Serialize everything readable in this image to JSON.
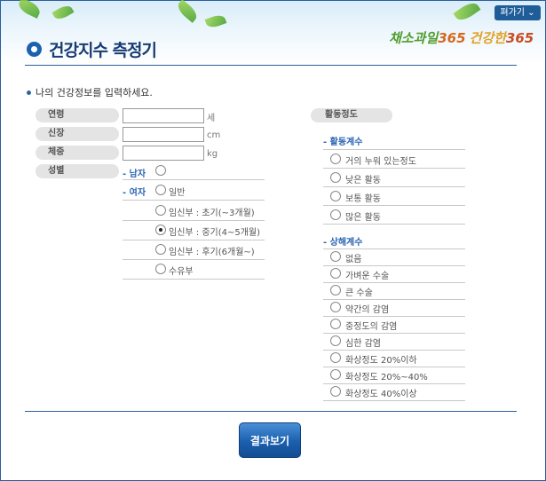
{
  "header": {
    "close_label": "펴가기 ⌄",
    "title": "건강지수 측정기",
    "brand_part1": "채소과일",
    "brand_part2": "365",
    "brand_part3": "건강한",
    "brand_part4": "365"
  },
  "intro": "나의 건강정보를 입력하세요.",
  "fields": {
    "age_label": "연령",
    "height_label": "신장",
    "height_unit": "cm",
    "weight_label": "체중",
    "weight_unit": "kg",
    "age_unit": "세",
    "gender_label": "성별",
    "age_value": "",
    "height_value": "",
    "weight_value": ""
  },
  "gender": {
    "male_label": "- 남자",
    "female_label": "- 여자",
    "female_options": [
      "일반",
      "임신부 : 초기(~3개월)",
      "임신부 : 중기(4~5개월)",
      "임신부 : 후기(6개월~)",
      "수유부"
    ],
    "selected": "임신부 : 중기(4~5개월)"
  },
  "activity": {
    "header_label": "활동정도",
    "activity_title": "- 활동계수",
    "activity_options": [
      "거의 누워 있는정도",
      "낮은 활동",
      "보통 활동",
      "많은 활동"
    ],
    "injury_title": "- 상해계수",
    "injury_options": [
      "없음",
      "가벼운 수술",
      "큰 수술",
      "약간의 감염",
      "중정도의 감염",
      "심한 감염",
      "화상정도 20%이하",
      "화상정도 20%~40%",
      "화상정도 40%이상"
    ]
  },
  "result_button": "결과보기",
  "colors": {
    "accent": "#1a62ae",
    "title": "#173c73",
    "option_label": "#2a64b4",
    "frame": "#2a5f9c"
  }
}
